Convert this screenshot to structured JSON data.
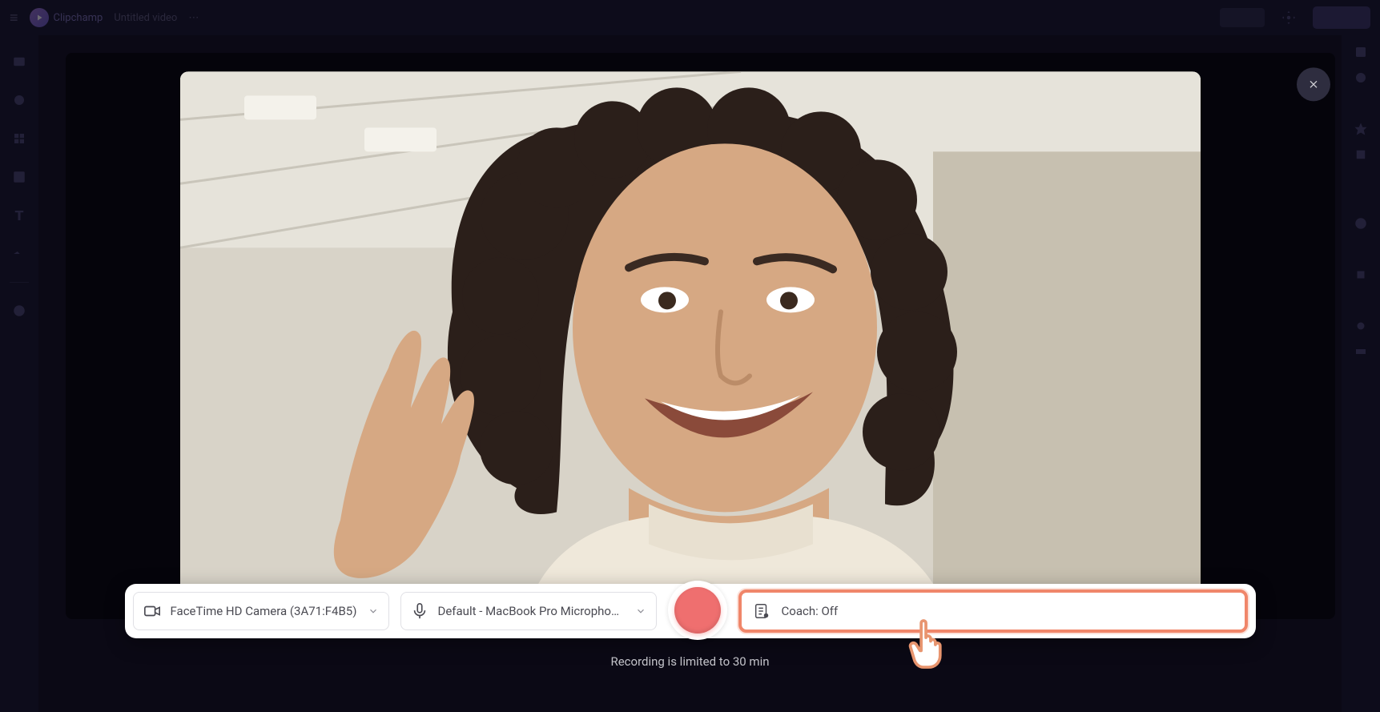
{
  "app": {
    "name": "Clipchamp",
    "breadcrumb": "Untitled video"
  },
  "recording": {
    "camera_label": "FaceTime HD Camera (3A71:F4B5)",
    "mic_label": "Default - MacBook Pro Microphone (...",
    "coach_label": "Coach: Off",
    "status_text": "Recording is limited to 30 min"
  }
}
